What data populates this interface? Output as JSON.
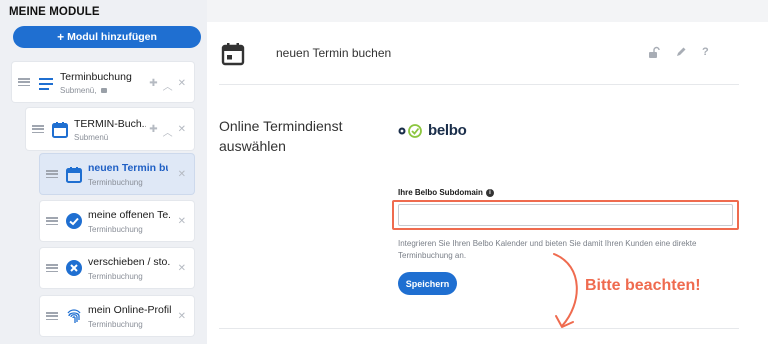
{
  "sidebar": {
    "title": "MEINE MODULE",
    "add_button": "Modul hinzufügen",
    "modules": [
      {
        "title": "Terminbuchung",
        "subtitle": "Submenü,",
        "icon": "list-icon"
      },
      {
        "title": "TERMIN-Buch...",
        "subtitle": "Submenü",
        "icon": "calendar-icon"
      },
      {
        "title": "neuen Termin bu",
        "subtitle": "Terminbuchung",
        "icon": "calendar-icon"
      },
      {
        "title": "meine offenen Te...",
        "subtitle": "Terminbuchung",
        "icon": "check-circle-icon"
      },
      {
        "title": "verschieben / sto...",
        "subtitle": "Terminbuchung",
        "icon": "cancel-circle-icon"
      },
      {
        "title": "mein Online-Profil",
        "subtitle": "Terminbuchung",
        "icon": "fingerprint-icon"
      }
    ]
  },
  "header": {
    "title": "neuen Termin buchen",
    "icon": "calendar-icon",
    "tools": [
      "unlock-icon",
      "pencil-icon",
      "help-icon"
    ]
  },
  "content": {
    "section_label": "Online Termindienst auswählen",
    "logo_text": "belbo",
    "field_label": "Ihre Belbo Subdomain",
    "field_value": "",
    "help_text": "Integrieren Sie Ihren Belbo Kalender und bieten Sie damit Ihren Kunden eine direkte Terminbuchung an.",
    "save_button": "Speichern"
  },
  "annotation": {
    "text": "Bitte beachten!",
    "color": "#ef6b4f"
  },
  "colors": {
    "accent": "#1f6fd1",
    "annotation": "#ef6b4f",
    "sidebar_bg": "#eef0f4"
  }
}
